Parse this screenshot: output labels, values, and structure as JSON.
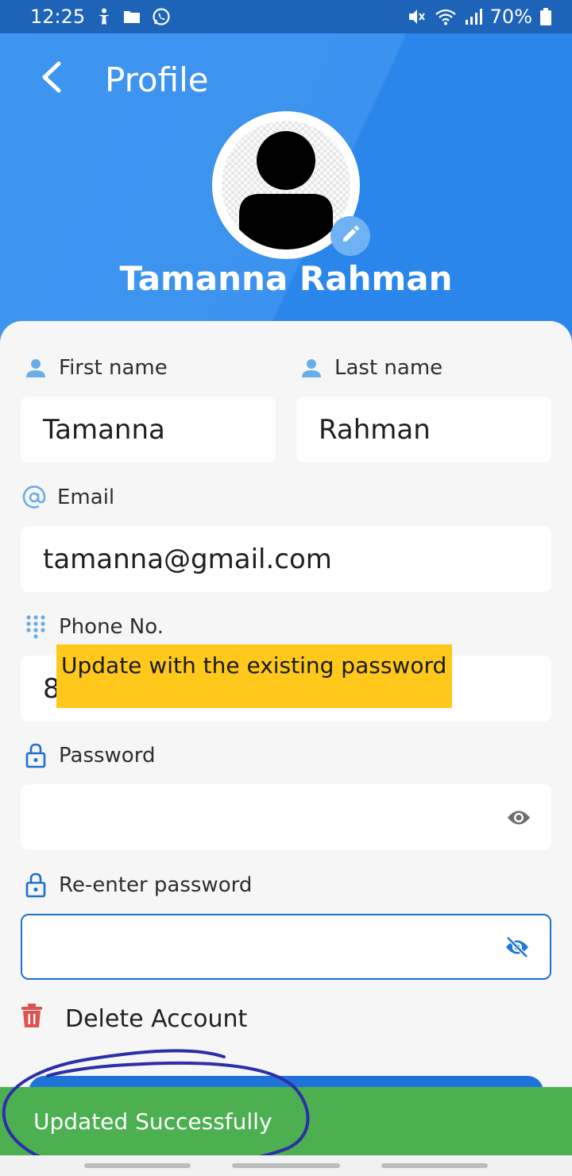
{
  "status_bar": {
    "time": "12:25",
    "battery": "70%"
  },
  "header": {
    "title": "Profile",
    "user_name": "Tamanna Rahman"
  },
  "form": {
    "first_name": {
      "label": "First name",
      "value": "Tamanna"
    },
    "last_name": {
      "label": "Last name",
      "value": "Rahman"
    },
    "email": {
      "label": "Email",
      "value": "tamanna@gmail.com"
    },
    "phone": {
      "label": "Phone No.",
      "value_visible": "8"
    },
    "password": {
      "label": "Password",
      "value": ""
    },
    "reenter_password": {
      "label": "Re-enter password",
      "value": ""
    }
  },
  "tooltip": "Update with the existing password",
  "delete_label": "Delete Account",
  "snackbar": "Updated Successfully",
  "colors": {
    "header_blue": "#2a86ea",
    "status_blue": "#1d64b8",
    "field_bg": "#ffffff",
    "icon_blue": "#6aaee9",
    "lock_blue": "#1e6fcf",
    "delete_red": "#e05252",
    "snackbar_green": "#4caf50",
    "tooltip_yellow": "#ffc81a",
    "annotation_ink": "#2d2fa8"
  },
  "icons": {
    "back": "chevron-left-icon",
    "edit": "pencil-icon",
    "person": "person-icon",
    "email": "at-icon",
    "phone": "dialpad-icon",
    "lock": "lock-icon",
    "eye": "eye-icon",
    "eye_off": "eye-off-icon",
    "delete": "trash-icon"
  }
}
